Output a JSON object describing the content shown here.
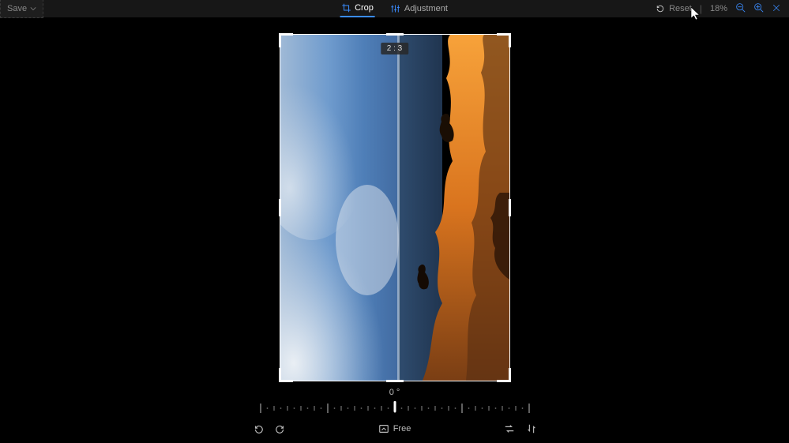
{
  "toolbar": {
    "save": "Save",
    "tabs": {
      "crop": "Crop",
      "adjustment": "Adjustment"
    },
    "reset": "Reset",
    "zoom": "18%"
  },
  "canvas": {
    "ratio_badge": "2 : 3"
  },
  "controls": {
    "rotation_deg": "0 °",
    "aspect_mode": "Free"
  }
}
